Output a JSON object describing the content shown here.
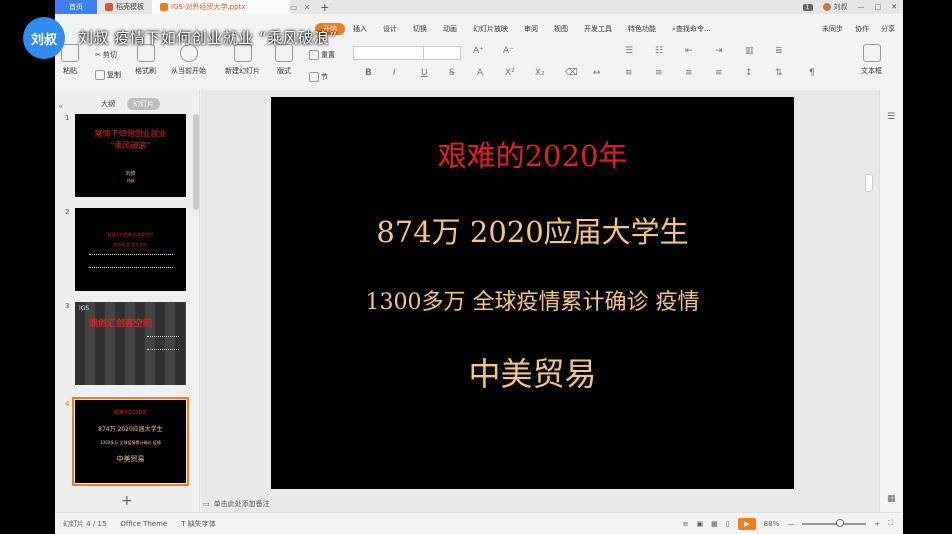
{
  "overlay": {
    "avatar_label": "刘叔",
    "caption": "刘叔 疫情下如何创业就业 “乘风破浪”"
  },
  "tabs": {
    "home": "首页",
    "tab2": "稻壳模板",
    "tab3": "IGS-对外经贸大学.pptx"
  },
  "window": {
    "badge": "1",
    "username": "刘叔",
    "controls": [
      "—",
      "□",
      "✕"
    ]
  },
  "menu": {
    "items": [
      "开始",
      "插入",
      "设计",
      "切换",
      "动画",
      "幻灯片放映",
      "审阅",
      "视图",
      "开发工具",
      "特色功能"
    ],
    "search": "查找命令...",
    "right": [
      "未同步",
      "协作",
      "分享"
    ]
  },
  "ribbon": {
    "paste": "粘贴",
    "cut": "剪切",
    "copy": "复制",
    "format_painter": "格式刷",
    "from_start": "从当前开始",
    "new_slide": "新建幻灯片",
    "layout": "版式",
    "section": "节",
    "reset": "重置",
    "text_box": "文本框"
  },
  "left_panel": {
    "tabs": [
      "大纲",
      "幻灯片"
    ],
    "thumbs": [
      {
        "num": "1",
        "title": "疫情下如何创业就业",
        "subtitle": "“乘风破浪”",
        "author": "刘叔",
        "note": "刘叔"
      },
      {
        "num": "2",
        "line1": "疫情下的困难 形势及应对",
        "line2": "创业机会 就业方向"
      },
      {
        "num": "3",
        "brand": "IGS",
        "title": "鼎创汇创客空间"
      },
      {
        "num": "4",
        "line1": "艰难的2020年",
        "line2": "874万 2020应届大学生",
        "line3": "1300多万 全球疫情累计确诊 疫情",
        "line4": "中美贸易"
      }
    ]
  },
  "slide": {
    "line1": "艰难的2020年",
    "line2": "874万  2020应届大学生",
    "line3": "1300多万 全球疫情累计确诊 疫情",
    "line4": "中美贸易",
    "colors": {
      "title": "#e02020",
      "body": "#f5c77e"
    }
  },
  "notes_placeholder": "单击此处添加备注",
  "status": {
    "slide_count": "幻灯片 4 / 15",
    "theme": "Office Theme",
    "missing_font": "缺失字体",
    "zoom": "88%"
  }
}
